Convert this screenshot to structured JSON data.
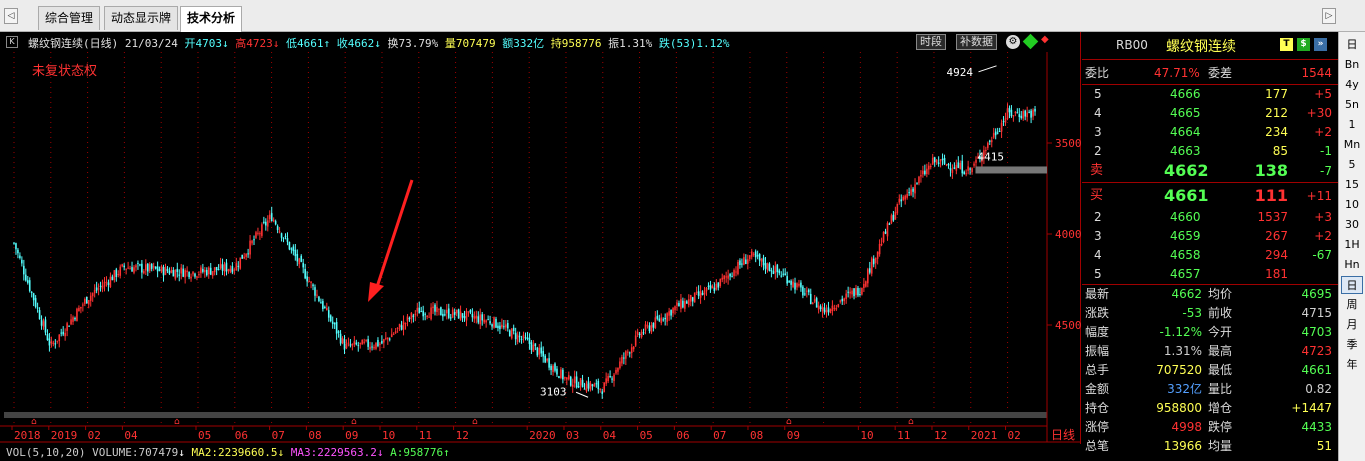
{
  "tabs": {
    "prev": "◁",
    "items": [
      "综合管理",
      "动态显示牌",
      "技术分析"
    ],
    "active": 2,
    "next": "▷"
  },
  "chart": {
    "info": {
      "kbtn": "K",
      "name": "螺纹钢连续(日线)",
      "date": "21/03/24",
      "open": "开4703",
      "high": "高4723",
      "low": "低4661",
      "close": "收4662",
      "turnover": "换73.79%",
      "volume": "量707479",
      "amount": "额332亿",
      "hold": "持958776",
      "amplitude": "振1.31%",
      "change": "跌(53)1.12%"
    },
    "fuquan": "未复状态权",
    "buttons": {
      "period": "时段",
      "supplement": "补数据"
    },
    "axis_unit": "日线",
    "y_ticks": [
      "4500",
      "4000",
      "3500"
    ],
    "x_ticks": [
      "2018",
      "2019",
      "02",
      "04",
      "05",
      "06",
      "07",
      "08",
      "09",
      "10",
      "11",
      "12",
      "2020",
      "03",
      "04",
      "05",
      "06",
      "07",
      "08",
      "09",
      "10",
      "11",
      "12",
      "2021",
      "02"
    ],
    "annotations": {
      "high": "4924",
      "low": "3103",
      "recent": "4415"
    }
  },
  "chart_data": {
    "type": "candlestick",
    "title": "螺纹钢连续(日线)",
    "ylim": [
      3000,
      5000
    ],
    "y_ticks": [
      3500,
      4000,
      4500
    ],
    "x_ticks": [
      "2018",
      "2019",
      "02",
      "04",
      "05",
      "06",
      "07",
      "08",
      "09",
      "10",
      "11",
      "12",
      "2020",
      "03",
      "04",
      "05",
      "06",
      "07",
      "08",
      "09",
      "10",
      "11",
      "12",
      "2021",
      "02"
    ],
    "x_range": [
      "2018-12",
      "2021-03"
    ],
    "trend_points": [
      [
        "2018-12",
        3950
      ],
      [
        "2019-01",
        3380
      ],
      [
        "2019-02",
        3650
      ],
      [
        "2019-03",
        3820
      ],
      [
        "2019-04",
        3800
      ],
      [
        "2019-05",
        3790
      ],
      [
        "2019-06",
        3820
      ],
      [
        "2019-07",
        4100
      ],
      [
        "2019-08",
        3750
      ],
      [
        "2019-09",
        3380
      ],
      [
        "2019-10",
        3400
      ],
      [
        "2019-11",
        3580
      ],
      [
        "2019-12",
        3560
      ],
      [
        "2020-01",
        3520
      ],
      [
        "2020-02",
        3400
      ],
      [
        "2020-03",
        3200
      ],
      [
        "2020-04",
        3150
      ],
      [
        "2020-05",
        3450
      ],
      [
        "2020-06",
        3600
      ],
      [
        "2020-07",
        3700
      ],
      [
        "2020-08",
        3880
      ],
      [
        "2020-09",
        3760
      ],
      [
        "2020-10",
        3580
      ],
      [
        "2020-11",
        3700
      ],
      [
        "2020-12",
        4150
      ],
      [
        "2021-01",
        4400
      ],
      [
        "2021-02",
        4350
      ],
      [
        "2021-03",
        4662
      ]
    ],
    "annotations": [
      {
        "label": "4924",
        "value": 4924
      },
      {
        "label": "3103",
        "value": 3103
      },
      {
        "label": "4415",
        "value": 4415
      }
    ],
    "last": {
      "open": 4703,
      "high": 4723,
      "low": 4661,
      "close": 4662
    },
    "colors": {
      "up": "#ff3232",
      "down": "#54ffff",
      "grid": "#a00000"
    }
  },
  "indicator": {
    "vol": "VOL(5,10,20)",
    "volume": "VOLUME:707479",
    "ma2": "MA2:2239660.5",
    "ma3": "MA3:2229563.2",
    "a": "A:958776"
  },
  "quote": {
    "code": "RB00",
    "name": "螺纹钢连续",
    "weibi_label": "委比",
    "weibi": "47.71%",
    "weicha_label": "委差",
    "weicha": "1544",
    "asks": [
      {
        "level": "5",
        "price": "4666",
        "vol": "177",
        "chg": "+5"
      },
      {
        "level": "4",
        "price": "4665",
        "vol": "212",
        "chg": "+30"
      },
      {
        "level": "3",
        "price": "4664",
        "vol": "234",
        "chg": "+2"
      },
      {
        "level": "2",
        "price": "4663",
        "vol": "85",
        "chg": "-1"
      }
    ],
    "ask1": {
      "label": "卖",
      "price": "4662",
      "vol": "138",
      "chg": "-7"
    },
    "bid1": {
      "label": "买",
      "price": "4661",
      "vol": "111",
      "chg": "+11"
    },
    "bids": [
      {
        "level": "2",
        "price": "4660",
        "vol": "1537",
        "chg": "+3"
      },
      {
        "level": "3",
        "price": "4659",
        "vol": "267",
        "chg": "+2"
      },
      {
        "level": "4",
        "price": "4658",
        "vol": "294",
        "chg": "-67"
      },
      {
        "level": "5",
        "price": "4657",
        "vol": "181",
        "chg": ""
      }
    ],
    "stats": [
      {
        "l1": "最新",
        "v1": "4662",
        "c1": "#54ff54",
        "l2": "均价",
        "v2": "4695",
        "c2": "#54ff54"
      },
      {
        "l1": "涨跌",
        "v1": "-53",
        "c1": "#54ff54",
        "l2": "前收",
        "v2": "4715",
        "c2": "#d0d0d0"
      },
      {
        "l1": "幅度",
        "v1": "-1.12%",
        "c1": "#54ff54",
        "l2": "今开",
        "v2": "4703",
        "c2": "#54ff54"
      },
      {
        "l1": "振幅",
        "v1": "1.31%",
        "c1": "#d0d0d0",
        "l2": "最高",
        "v2": "4723",
        "c2": "#ff3232"
      },
      {
        "l1": "总手",
        "v1": "707520",
        "c1": "#ffff54",
        "l2": "最低",
        "v2": "4661",
        "c2": "#54ff54"
      },
      {
        "l1": "金额",
        "v1": "332亿",
        "c1": "#54a0ff",
        "l2": "量比",
        "v2": "0.82",
        "c2": "#d0d0d0"
      },
      {
        "l1": "持仓",
        "v1": "958800",
        "c1": "#ffff54",
        "l2": "增仓",
        "v2": "+1447",
        "c2": "#ffff54"
      },
      {
        "l1": "涨停",
        "v1": "4998",
        "c1": "#ff3232",
        "l2": "跌停",
        "v2": "4433",
        "c2": "#54ff54"
      },
      {
        "l1": "总笔",
        "v1": "13966",
        "c1": "#ffff54",
        "l2": "均量",
        "v2": "51",
        "c2": "#ffff54"
      }
    ]
  },
  "toolbar": [
    "日",
    "Bn",
    "4y",
    "5n",
    "1",
    "Mn",
    "5",
    "15",
    "10",
    "30",
    "1H",
    "Hn",
    "日",
    "周",
    "月",
    "季",
    "年"
  ],
  "toolbar_selected": 12
}
